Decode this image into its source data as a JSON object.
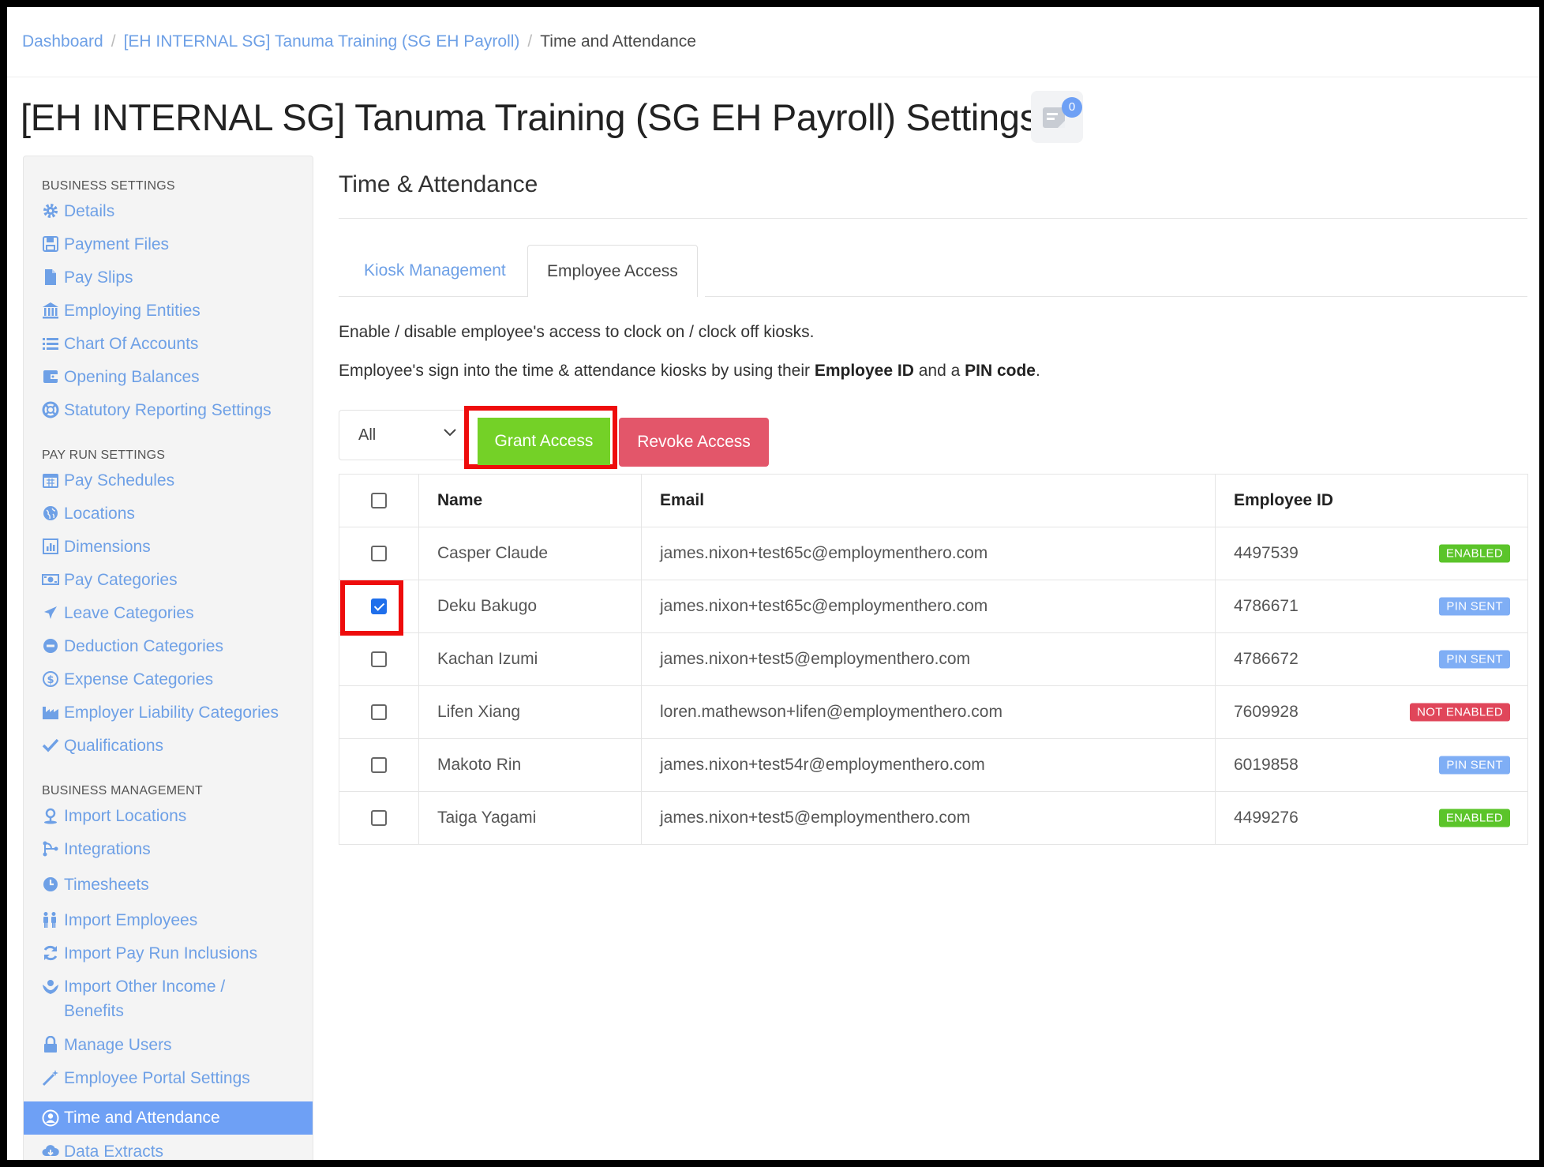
{
  "breadcrumb": {
    "items": [
      "Dashboard",
      "[EH INTERNAL SG] Tanuma Training (SG EH Payroll)"
    ],
    "current": "Time and Attendance"
  },
  "page_title": "[EH INTERNAL SG] Tanuma Training (SG EH Payroll) Settings",
  "notes_count": "0",
  "sidebar": {
    "business_settings_heading": "BUSINESS SETTINGS",
    "business_settings": [
      {
        "label": "Details",
        "icon": "gear-icon"
      },
      {
        "label": "Payment Files",
        "icon": "save-icon"
      },
      {
        "label": "Pay Slips",
        "icon": "file-icon"
      },
      {
        "label": "Employing Entities",
        "icon": "bank-icon"
      },
      {
        "label": "Chart Of Accounts",
        "icon": "list-icon"
      },
      {
        "label": "Opening Balances",
        "icon": "wallet-icon"
      },
      {
        "label": "Statutory Reporting Settings",
        "icon": "lifebuoy-icon"
      }
    ],
    "pay_run_heading": "PAY RUN SETTINGS",
    "pay_run_settings": [
      {
        "label": "Pay Schedules",
        "icon": "calendar-icon"
      },
      {
        "label": "Locations",
        "icon": "globe-icon"
      },
      {
        "label": "Dimensions",
        "icon": "bar-chart-icon"
      },
      {
        "label": "Pay Categories",
        "icon": "money-icon"
      },
      {
        "label": "Leave Categories",
        "icon": "plane-icon"
      },
      {
        "label": "Deduction Categories",
        "icon": "minus-circle-icon"
      },
      {
        "label": "Expense Categories",
        "icon": "dollar-circle-icon"
      },
      {
        "label": "Employer Liability Categories",
        "icon": "factory-icon"
      },
      {
        "label": "Qualifications",
        "icon": "check-icon"
      }
    ],
    "business_management_heading": "BUSINESS MANAGEMENT",
    "business_management": [
      {
        "label": "Import Locations",
        "icon": "pin-icon"
      },
      {
        "label": "Integrations",
        "icon": "integration-icon"
      },
      {
        "label": "Timesheets",
        "icon": "clock-icon"
      },
      {
        "label": "Import Employees",
        "icon": "people-icon"
      },
      {
        "label": "Import Pay Run Inclusions",
        "icon": "refresh-icon"
      },
      {
        "label": "Import Other Income / Benefits",
        "icon": "hands-icon"
      },
      {
        "label": "Manage Users",
        "icon": "lock-icon"
      },
      {
        "label": "Employee Portal Settings",
        "icon": "wand-icon"
      },
      {
        "label": "Time and Attendance",
        "icon": "user-circle-icon",
        "active": true
      },
      {
        "label": "Data Extracts",
        "icon": "cloud-download-icon"
      }
    ]
  },
  "section_title": "Time & Attendance",
  "tabs": [
    {
      "label": "Kiosk Management",
      "active": false
    },
    {
      "label": "Employee Access",
      "active": true
    }
  ],
  "description": {
    "line1": "Enable / disable employee's access to clock on / clock off kiosks.",
    "line2_prefix": "Employee's sign into the time & attendance kiosks by using their ",
    "line2_bold1": "Employee ID",
    "line2_mid": " and a ",
    "line2_bold2": "PIN code",
    "line2_suffix": "."
  },
  "filter": {
    "selected": "All"
  },
  "buttons": {
    "grant": "Grant Access",
    "revoke": "Revoke Access"
  },
  "table": {
    "headers": [
      "Name",
      "Email",
      "Employee ID"
    ],
    "rows": [
      {
        "name": "Casper Claude",
        "email": "james.nixon+test65c@employmenthero.com",
        "employee_id": "4497539",
        "status": "ENABLED",
        "checked": false
      },
      {
        "name": "Deku Bakugo",
        "email": "james.nixon+test65c@employmenthero.com",
        "employee_id": "4786671",
        "status": "PIN SENT",
        "checked": true
      },
      {
        "name": "Kachan Izumi",
        "email": "james.nixon+test5@employmenthero.com",
        "employee_id": "4786672",
        "status": "PIN SENT",
        "checked": false
      },
      {
        "name": "Lifen Xiang",
        "email": "loren.mathewson+lifen@employmenthero.com",
        "employee_id": "7609928",
        "status": "NOT ENABLED",
        "checked": false
      },
      {
        "name": "Makoto Rin",
        "email": "james.nixon+test54r@employmenthero.com",
        "employee_id": "6019858",
        "status": "PIN SENT",
        "checked": false
      },
      {
        "name": "Taiga Yagami",
        "email": "james.nixon+test5@employmenthero.com",
        "employee_id": "4499276",
        "status": "ENABLED",
        "checked": false
      }
    ]
  },
  "colors": {
    "link": "#6ea0e6",
    "grant": "#74d127",
    "revoke": "#e3566a",
    "enabled": "#5bc42a",
    "pin_sent": "#7faef5",
    "not_enabled": "#e0465a",
    "highlight": "#ee0c0c"
  }
}
